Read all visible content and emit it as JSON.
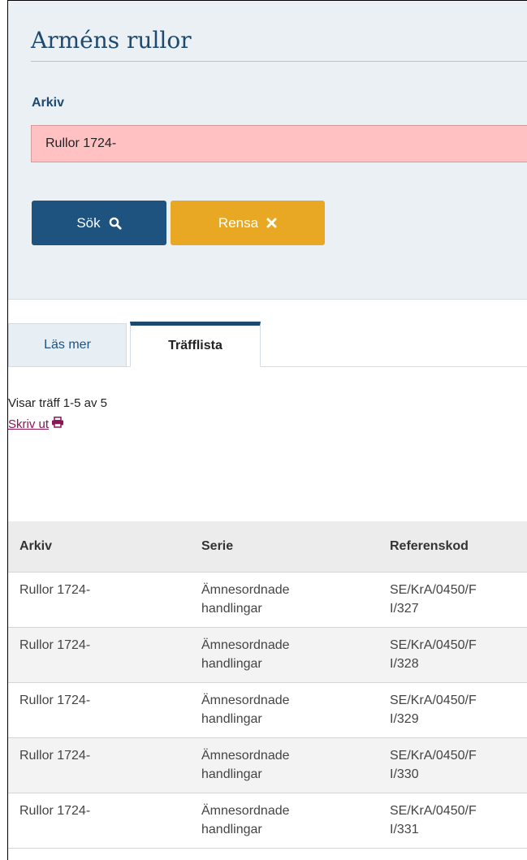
{
  "title": "Arméns rullor",
  "form": {
    "archive_label": "Arkiv",
    "archive_value": "Rullor 1724-",
    "search_label": "Sök",
    "clear_label": "Rensa"
  },
  "tabs": [
    {
      "label": "Läs mer"
    },
    {
      "label": "Träfflista"
    }
  ],
  "results": {
    "hits_text": "Visar träff 1-5 av 5",
    "print_label": "Skriv ut"
  },
  "table": {
    "headers": [
      "Arkiv",
      "Serie",
      "Referenskod"
    ],
    "rows": [
      {
        "arkiv": "Rullor 1724-",
        "serie_1": "Ämnesordnade",
        "serie_2": "handlingar",
        "ref_1": "SE/KrA/0450/F",
        "ref_2": "I/327"
      },
      {
        "arkiv": "Rullor 1724-",
        "serie_1": "Ämnesordnade",
        "serie_2": "handlingar",
        "ref_1": "SE/KrA/0450/F",
        "ref_2": "I/328"
      },
      {
        "arkiv": "Rullor 1724-",
        "serie_1": "Ämnesordnade",
        "serie_2": "handlingar",
        "ref_1": "SE/KrA/0450/F",
        "ref_2": "I/329"
      },
      {
        "arkiv": "Rullor 1724-",
        "serie_1": "Ämnesordnade",
        "serie_2": "handlingar",
        "ref_1": "SE/KrA/0450/F",
        "ref_2": "I/330"
      },
      {
        "arkiv": "Rullor 1724-",
        "serie_1": "Ämnesordnade",
        "serie_2": "handlingar",
        "ref_1": "SE/KrA/0450/F",
        "ref_2": "I/331"
      }
    ]
  },
  "icons": {
    "search": "search-icon",
    "clear": "close-icon",
    "print": "printer-icon"
  },
  "colors": {
    "primary": "#1e5380",
    "accent": "#e9a823",
    "error_field": "#ffc1c1",
    "link": "#8e1458"
  }
}
